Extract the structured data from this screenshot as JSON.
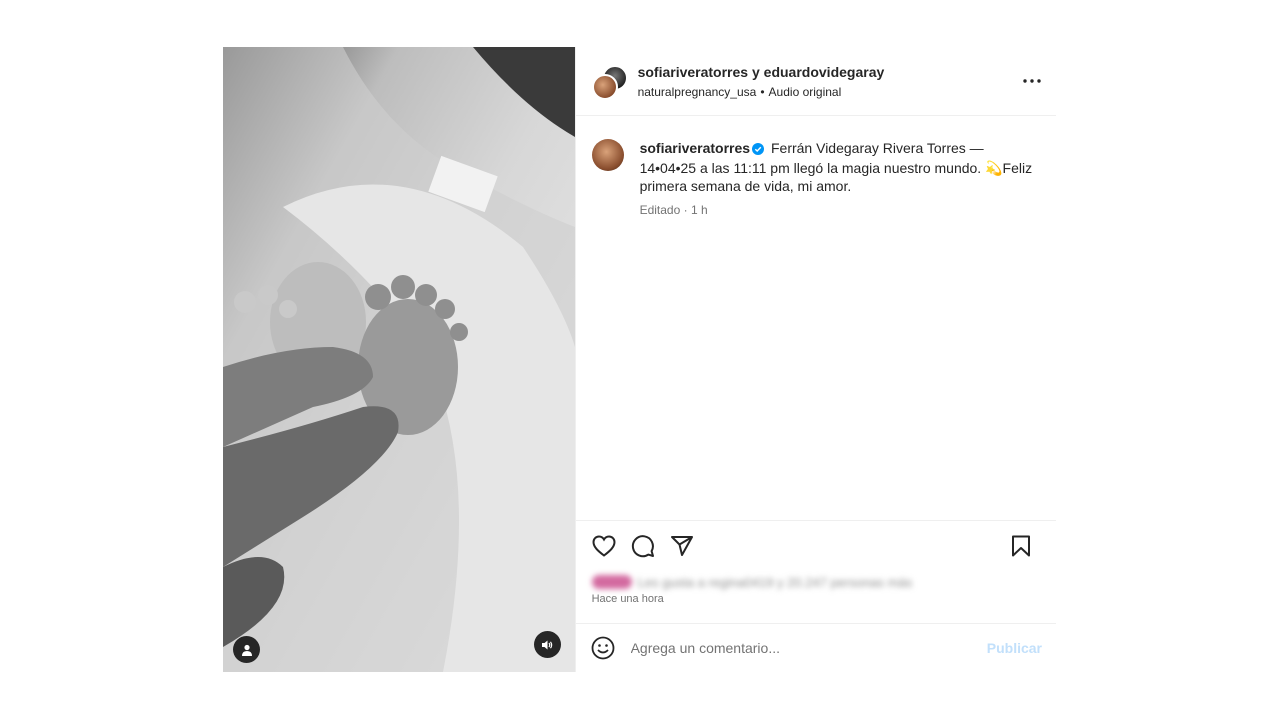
{
  "header": {
    "user1": "sofiariveratorres",
    "conjunction": " y ",
    "user2": "eduardovidegaray",
    "audio_account": "naturalpregnancy_usa",
    "audio_sep": "•",
    "audio_label": "Audio original"
  },
  "caption": {
    "username": "sofiariveratorres",
    "text": "Ferrán Videgaray Rivera Torres — 14•04•25 a las 11:11 pm llegó la magia nuestro mundo. 💫Feliz primera semana de vida, mi amor.",
    "meta": "Editado · 1 h"
  },
  "likes": {
    "text": "Les gusta a regina0419 y 20.247 personas más"
  },
  "timestamp": "Hace una hora",
  "comment": {
    "placeholder": "Agrega un comentario...",
    "publish_label": "Publicar"
  },
  "icons": {
    "more": "more-horizontal-icon",
    "like": "heart-icon",
    "comment": "comment-bubble-icon",
    "share": "paper-plane-icon",
    "save": "bookmark-icon",
    "emoji": "emoji-smile-icon",
    "tagged_user": "user-icon",
    "audio": "speaker-icon",
    "verified": "verified-badge-icon"
  },
  "colors": {
    "verified": "#0095f6",
    "publish_disabled": "#c2e0fb",
    "secondary_text": "#737373"
  }
}
